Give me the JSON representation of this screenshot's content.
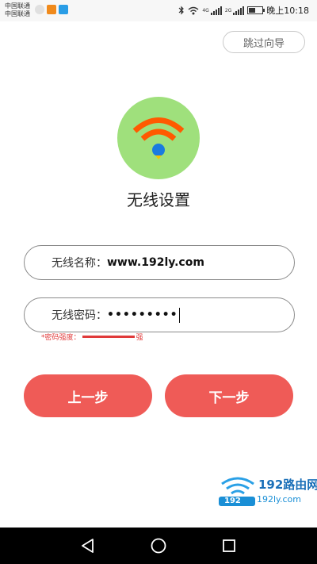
{
  "status_bar": {
    "carrier_1": "中国联通",
    "carrier_2": "中国联通",
    "net_1": "4G",
    "net_2": "2G",
    "time": "晚上10:18"
  },
  "header": {
    "skip_label": "跳过向导"
  },
  "logo": {
    "icon": "wifi-icon",
    "bg_color": "#9fe07c",
    "arc_color": "#ff5a00",
    "dot_color": "#1a7be0"
  },
  "page": {
    "title": "无线设置"
  },
  "form": {
    "ssid_label": "无线名称：",
    "ssid_value": "www.192ly.com",
    "password_label": "无线密码：",
    "password_value": "•••••••••",
    "strength_label": "*密码强度：",
    "strength_value": "强",
    "strength_level": 1.0
  },
  "buttons": {
    "prev_label": "上一步",
    "next_label": "下一步",
    "color": "#ef5b57"
  },
  "watermark": {
    "brand": "192路由网",
    "url": "192ly.com",
    "badge": "192"
  },
  "nav": {
    "back_icon": "back-triangle-icon",
    "home_icon": "home-circle-icon",
    "recent_icon": "recent-square-icon"
  }
}
